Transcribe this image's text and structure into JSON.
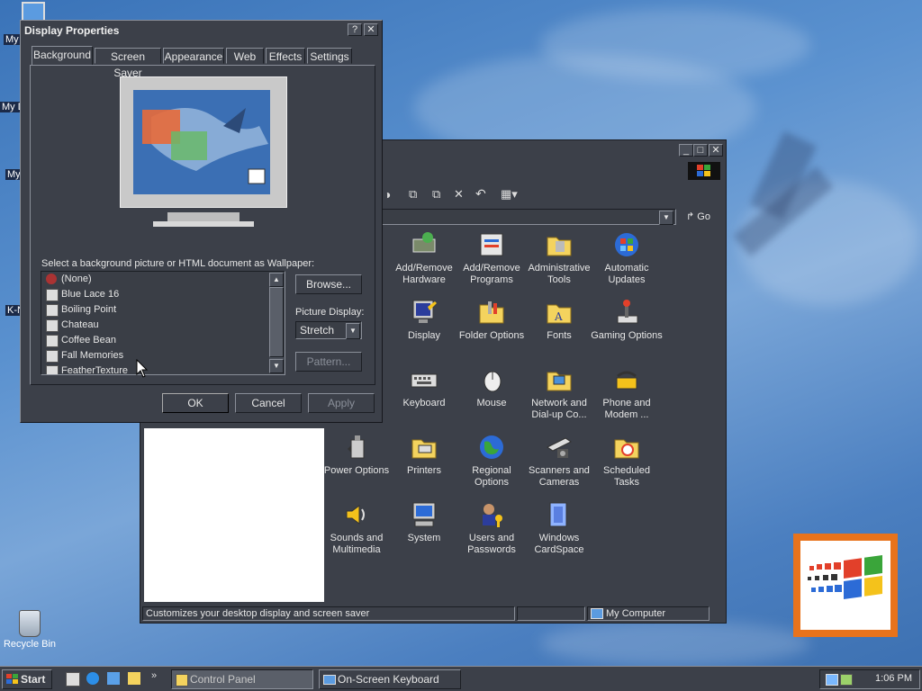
{
  "desktop": {
    "icons": [
      {
        "label": "My"
      },
      {
        "label": "My D"
      },
      {
        "label": "My"
      },
      {
        "label": "K-N"
      },
      {
        "label": "Recycle Bin"
      }
    ]
  },
  "control_panel": {
    "go_label": "Go",
    "status_left": "Customizes your desktop display and screen saver",
    "status_right": "My Computer",
    "items": [
      {
        "label": "Add/Remove Hardware",
        "icon": "add-remove-hardware-icon"
      },
      {
        "label": "Add/Remove Programs",
        "icon": "add-remove-programs-icon"
      },
      {
        "label": "Administrative Tools",
        "icon": "administrative-tools-icon"
      },
      {
        "label": "Automatic Updates",
        "icon": "automatic-updates-icon"
      },
      {
        "label": "Display",
        "icon": "display-icon"
      },
      {
        "label": "Folder Options",
        "icon": "folder-options-icon"
      },
      {
        "label": "Fonts",
        "icon": "fonts-icon"
      },
      {
        "label": "Gaming Options",
        "icon": "gaming-options-icon"
      },
      {
        "label": "Keyboard",
        "icon": "keyboard-icon"
      },
      {
        "label": "Mouse",
        "icon": "mouse-icon"
      },
      {
        "label": "Network and Dial-up Co...",
        "icon": "network-icon"
      },
      {
        "label": "Phone and Modem ...",
        "icon": "phone-modem-icon"
      },
      {
        "label": "Power Options",
        "icon": "power-options-icon"
      },
      {
        "label": "Printers",
        "icon": "printers-icon"
      },
      {
        "label": "Regional Options",
        "icon": "regional-options-icon"
      },
      {
        "label": "Scanners and Cameras",
        "icon": "scanners-cameras-icon"
      },
      {
        "label": "Scheduled Tasks",
        "icon": "scheduled-tasks-icon"
      },
      {
        "label": "Sounds and Multimedia",
        "icon": "sounds-multimedia-icon"
      },
      {
        "label": "System",
        "icon": "system-icon"
      },
      {
        "label": "Users and Passwords",
        "icon": "users-passwords-icon"
      },
      {
        "label": "Windows CardSpace",
        "icon": "windows-cardspace-icon"
      }
    ]
  },
  "display_properties": {
    "title": "Display Properties",
    "help_glyph": "?",
    "close_glyph": "✕",
    "tabs": [
      "Background",
      "Screen Saver",
      "Appearance",
      "Web",
      "Effects",
      "Settings"
    ],
    "active_tab": "Background",
    "wallpaper_prompt": "Select a background picture or HTML document as Wallpaper:",
    "wallpapers": [
      "(None)",
      "Blue Lace 16",
      "Boiling Point",
      "Chateau",
      "Coffee Bean",
      "Fall Memories",
      "FeatherTexture"
    ],
    "browse_label": "Browse...",
    "picture_display_label": "Picture Display:",
    "picture_display_value": "Stretch",
    "pattern_label": "Pattern...",
    "ok_label": "OK",
    "cancel_label": "Cancel",
    "apply_label": "Apply"
  },
  "taskbar": {
    "start_label": "Start",
    "tasks": [
      {
        "label": "Control Panel"
      },
      {
        "label": "On-Screen Keyboard"
      }
    ],
    "clock": "1:06 PM"
  }
}
